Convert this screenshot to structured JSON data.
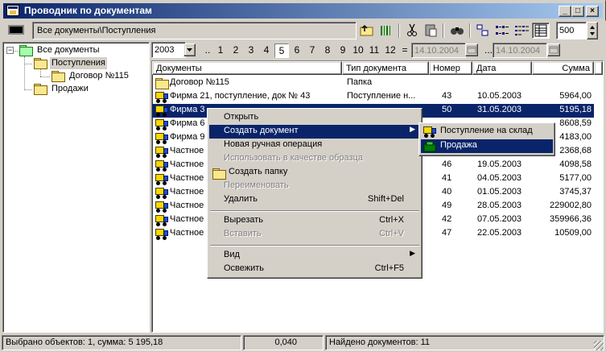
{
  "window": {
    "title": "Проводник по документам",
    "buttons": {
      "minimize": "_",
      "maximize": "□",
      "close": "×"
    }
  },
  "toolbar": {
    "address": "Все документы\\Поступления",
    "limit_value": "500",
    "icons": [
      "folder-up-icon",
      "barcode-icon",
      "cut-icon",
      "paste-icon",
      "find-icon",
      "large-icons-view-icon",
      "small-icons-view-icon",
      "list-view-icon",
      "details-view-icon"
    ]
  },
  "tree": {
    "items": [
      {
        "label": "Все документы"
      },
      {
        "label": "Поступления"
      },
      {
        "label": "Договор №115"
      },
      {
        "label": "Продажи"
      }
    ]
  },
  "filter": {
    "year": "2003",
    "dots": "..",
    "months": [
      "1",
      "2",
      "3",
      "4",
      "5",
      "6",
      "7",
      "8",
      "9",
      "10",
      "11",
      "12"
    ],
    "selected_month": "5",
    "eq": "=",
    "date_from": "14.10.2004",
    "range_sep": "...",
    "date_to": "14.10.2004"
  },
  "list": {
    "columns": [
      "Документы",
      "Тип документа",
      "Номер",
      "Дата",
      "Сумма"
    ],
    "rows": [
      {
        "name": "Договор №115",
        "type": "Папка",
        "number": "",
        "date": "",
        "sum": ""
      },
      {
        "name": "Фирма 21, поступление, док № 43",
        "type": "Поступление н...",
        "number": "43",
        "date": "10.05.2003",
        "sum": "5964,00"
      },
      {
        "name": "Фирма 3",
        "type": "",
        "number": "50",
        "date": "31.05.2003",
        "sum": "5195,18"
      },
      {
        "name": "Фирма 6",
        "type": "",
        "number": "",
        "date": "",
        "sum": "8608,59"
      },
      {
        "name": "Фирма 9",
        "type": "",
        "number": "",
        "date": "",
        "sum": "4183,00"
      },
      {
        "name": "Частное",
        "type": "",
        "number": "",
        "date": "",
        "sum": "2368,68"
      },
      {
        "name": "Частное",
        "type": "",
        "number": "46",
        "date": "19.05.2003",
        "sum": "4098,58"
      },
      {
        "name": "Частное",
        "type": "",
        "number": "41",
        "date": "04.05.2003",
        "sum": "5177,00"
      },
      {
        "name": "Частное",
        "type": "",
        "number": "40",
        "date": "01.05.2003",
        "sum": "3745,37"
      },
      {
        "name": "Частное",
        "type": "",
        "number": "49",
        "date": "28.05.2003",
        "sum": "229002,80"
      },
      {
        "name": "Частное",
        "type": "",
        "number": "42",
        "date": "07.05.2003",
        "sum": "359966,36"
      },
      {
        "name": "Частное",
        "type": "",
        "number": "47",
        "date": "22.05.2003",
        "sum": "10509,00"
      }
    ]
  },
  "context_menu": {
    "items": [
      {
        "label": "Открыть",
        "shortcut": "",
        "disabled": false,
        "highlighted": false,
        "submenu": false
      },
      {
        "label": "Создать документ",
        "shortcut": "",
        "disabled": false,
        "highlighted": true,
        "submenu": true
      },
      {
        "label": "Новая ручная операция",
        "shortcut": "",
        "disabled": false,
        "highlighted": false,
        "submenu": false
      },
      {
        "label": "Использовать в качестве образца",
        "shortcut": "",
        "disabled": true,
        "highlighted": false,
        "submenu": false
      },
      {
        "label": "Создать папку",
        "shortcut": "",
        "disabled": false,
        "highlighted": false,
        "submenu": false
      },
      {
        "label": "Переименовать",
        "shortcut": "",
        "disabled": true,
        "highlighted": false,
        "submenu": false
      },
      {
        "label": "Удалить",
        "shortcut": "Shift+Del",
        "disabled": false,
        "highlighted": false,
        "submenu": false
      },
      {
        "label": "Вырезать",
        "shortcut": "Ctrl+X",
        "disabled": false,
        "highlighted": false,
        "submenu": false
      },
      {
        "label": "Вставить",
        "shortcut": "Ctrl+V",
        "disabled": true,
        "highlighted": false,
        "submenu": false
      },
      {
        "label": "Вид",
        "shortcut": "",
        "disabled": false,
        "highlighted": false,
        "submenu": true
      },
      {
        "label": "Освежить",
        "shortcut": "Ctrl+F5",
        "disabled": false,
        "highlighted": false,
        "submenu": false
      }
    ]
  },
  "submenu": {
    "items": [
      {
        "label": "Поступление на склад"
      },
      {
        "label": "Продажа"
      }
    ]
  },
  "status": {
    "selected": "Выбрано объектов: 1, сумма: 5 195,18",
    "value": "0,040",
    "found": "Найдено документов: 11"
  },
  "colors": {
    "selection": "#0a246a",
    "face": "#d4d0c8",
    "title_gradient_end": "#a6caf0"
  }
}
